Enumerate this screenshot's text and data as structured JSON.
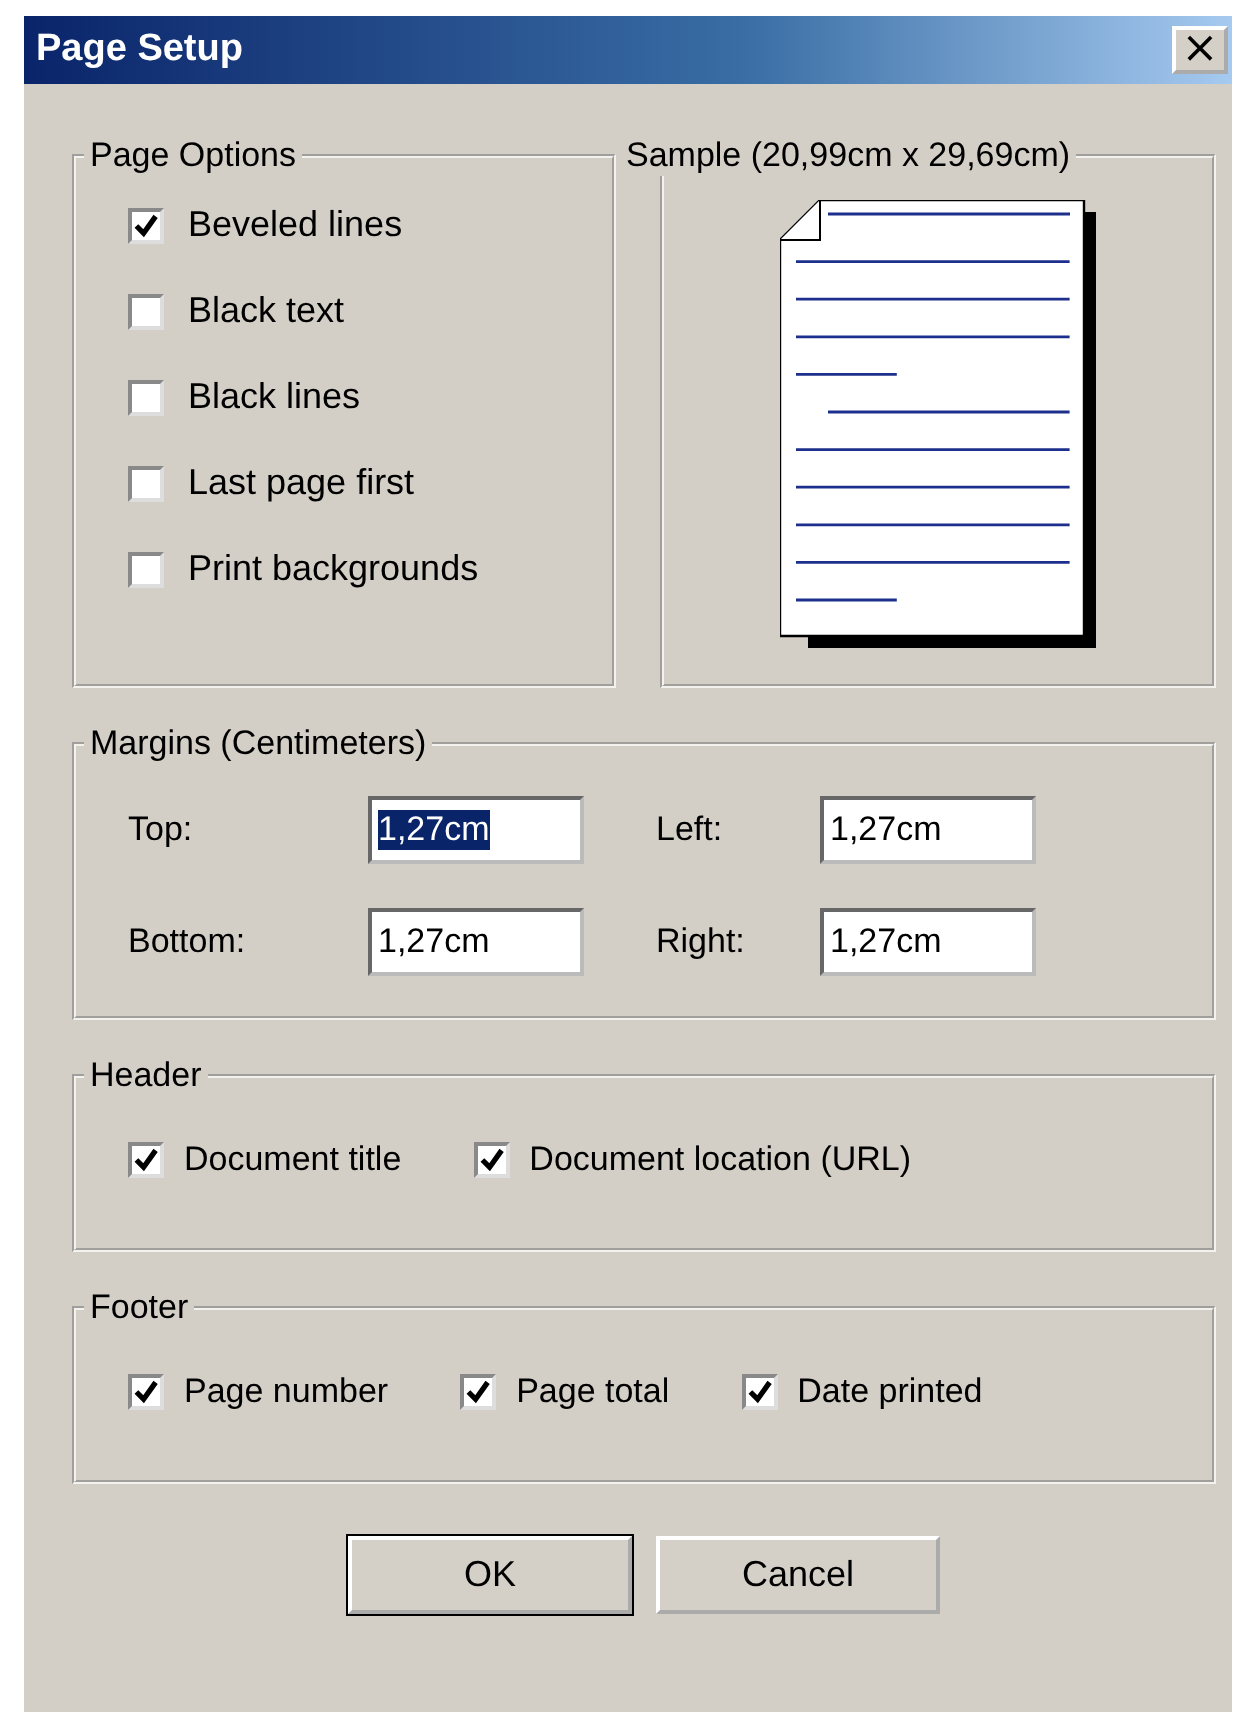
{
  "window": {
    "title": "Page Setup",
    "close": "×"
  },
  "page_options": {
    "title": "Page Options",
    "items": [
      {
        "label": "Beveled lines",
        "checked": true
      },
      {
        "label": "Black text",
        "checked": false
      },
      {
        "label": "Black lines",
        "checked": false
      },
      {
        "label": "Last page first",
        "checked": false
      },
      {
        "label": "Print backgrounds",
        "checked": false
      }
    ]
  },
  "sample": {
    "title": "Sample (20,99cm x 29,69cm)"
  },
  "margins": {
    "title": "Margins (Centimeters)",
    "fields": [
      {
        "label": "Top:",
        "value": "1,27cm",
        "selected": true
      },
      {
        "label": "Left:",
        "value": "1,27cm",
        "selected": false
      },
      {
        "label": "Bottom:",
        "value": "1,27cm",
        "selected": false
      },
      {
        "label": "Right:",
        "value": "1,27cm",
        "selected": false
      }
    ]
  },
  "header": {
    "title": "Header",
    "items": [
      {
        "label": "Document title",
        "checked": true
      },
      {
        "label": "Document location (URL)",
        "checked": true
      }
    ]
  },
  "footer": {
    "title": "Footer",
    "items": [
      {
        "label": "Page number",
        "checked": true
      },
      {
        "label": "Page total",
        "checked": true
      },
      {
        "label": "Date printed",
        "checked": true
      }
    ]
  },
  "buttons": [
    {
      "label": "OK",
      "default": true
    },
    {
      "label": "Cancel",
      "default": false
    }
  ]
}
